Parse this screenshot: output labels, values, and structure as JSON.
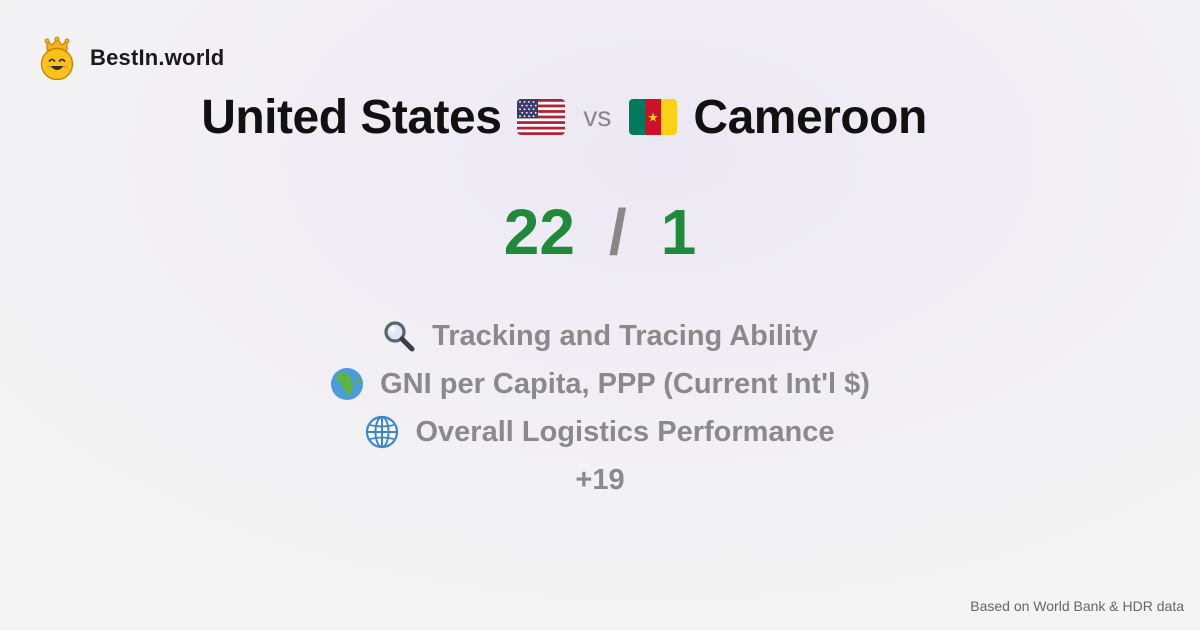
{
  "brand": {
    "name": "BestIn.world",
    "logo_icon": "crowned-smiley-icon"
  },
  "comparison": {
    "left_country": "United States",
    "left_flag_icon": "us-flag-icon",
    "vs_label": "vs",
    "right_country": "Cameroon",
    "right_flag_icon": "cameroon-flag-icon"
  },
  "score": {
    "left": "22",
    "separator": "/",
    "right": "1",
    "color": "#1e8a3a"
  },
  "metrics": [
    {
      "icon": "magnifying-glass-icon",
      "label": "Tracking and Tracing Ability"
    },
    {
      "icon": "globe-africa-icon",
      "label": "GNI per Capita, PPP (Current Int'l $)"
    },
    {
      "icon": "globe-meridians-icon",
      "label": "Overall Logistics Performance"
    }
  ],
  "more_count": "+19",
  "footer": {
    "source_note": "Based on World Bank & HDR data"
  }
}
